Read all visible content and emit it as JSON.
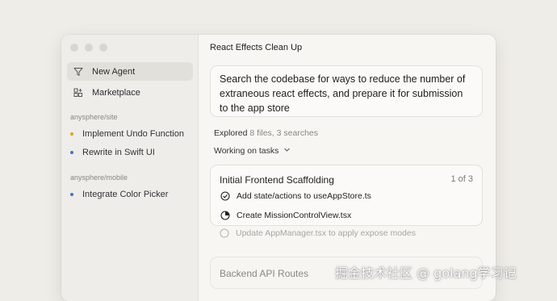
{
  "sidebar": {
    "nav": [
      {
        "label": "New Agent",
        "icon": "filter-icon"
      },
      {
        "label": "Marketplace",
        "icon": "grid-plus-icon"
      }
    ],
    "groups": [
      {
        "label": "anysphere/site",
        "tasks": [
          {
            "label": "Implement Undo Function",
            "color": "#e0a21a"
          },
          {
            "label": "Rewrite in Swift UI",
            "color": "#3a78c8"
          }
        ]
      },
      {
        "label": "anysphere/mobile",
        "tasks": [
          {
            "label": "Integrate Color Picker",
            "color": "#3a78c8"
          }
        ]
      }
    ]
  },
  "main": {
    "title": "React Effects Clean Up",
    "prompt": "Search the codebase for ways to reduce the number of extraneous react effects, and prepare it for submission to the app store",
    "explored": {
      "label": "Explored",
      "detail": "8 files, 3 searches"
    },
    "working": "Working on tasks",
    "card": {
      "title": "Initial Frontend Scaffolding",
      "count": "1 of 3",
      "steps": [
        {
          "label": "Add state/actions to useAppStore.ts",
          "status": "done"
        },
        {
          "label": "Create MissionControlView.tsx",
          "status": "in-progress"
        },
        {
          "label": "Update AppManager.tsx to apply expose modes",
          "status": "pending"
        }
      ]
    },
    "next_card": {
      "title": "Backend API Routes"
    }
  },
  "watermark": "掘金技术社区 @ golang学习记"
}
